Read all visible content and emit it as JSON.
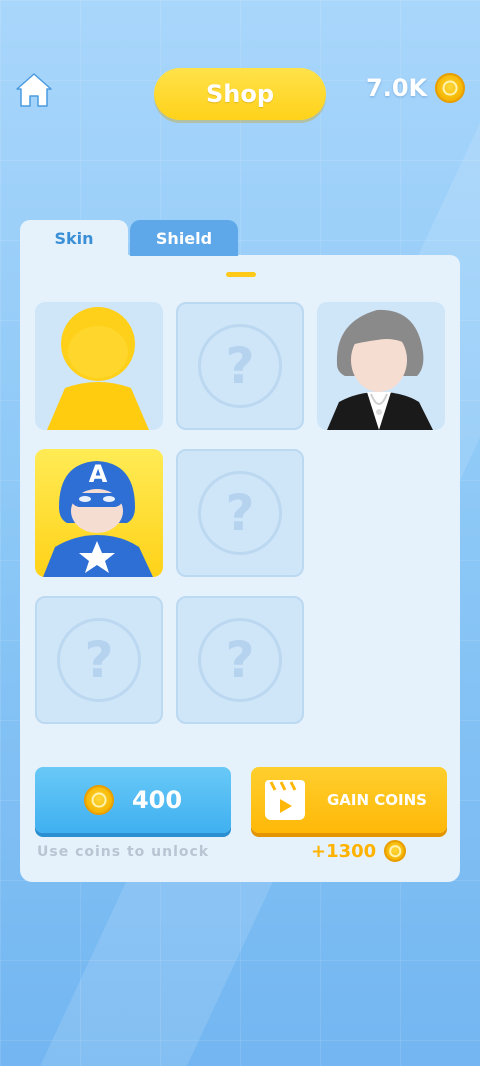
{
  "header": {
    "title": "Shop",
    "coin_total": "7.0K"
  },
  "tabs": [
    {
      "label": "Skin",
      "active": true
    },
    {
      "label": "Shield",
      "active": false
    }
  ],
  "skins": [
    {
      "name": "yellow-figure",
      "state": "owned"
    },
    {
      "name": "locked",
      "state": "locked",
      "glyph": "?"
    },
    {
      "name": "gray-hair-black-suit",
      "state": "owned"
    },
    {
      "name": "captain-hero",
      "state": "selected",
      "badge": "A"
    },
    {
      "name": "locked",
      "state": "locked",
      "glyph": "?"
    },
    {
      "name": "locked",
      "state": "locked",
      "glyph": "?"
    },
    {
      "name": "locked",
      "state": "locked",
      "glyph": "?"
    }
  ],
  "unlock": {
    "price": "400",
    "hint": "Use coins to unlock"
  },
  "gain": {
    "label": "GAIN COINS",
    "reward": "+1300"
  },
  "colors": {
    "accent_yellow": "#ffd21a",
    "accent_blue": "#3fb0f0",
    "panel": "#e6f2fb",
    "gain_orange": "#ffb808"
  },
  "icons": {
    "home": "home-icon",
    "coin": "coin-icon",
    "video": "video-icon"
  }
}
